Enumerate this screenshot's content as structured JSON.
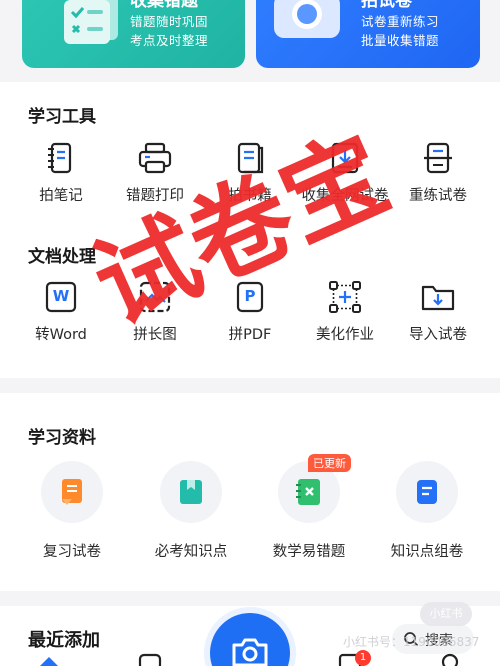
{
  "top_cards": {
    "left": {
      "title": "收集错题",
      "line1": "错题随时巩固",
      "line2": "考点及时整理"
    },
    "right": {
      "title": "拍试卷",
      "line1": "试卷重新练习",
      "line2": "批量收集错题"
    }
  },
  "tools": {
    "title": "学习工具",
    "items": [
      "拍笔记",
      "错题打印",
      "拍书籍",
      "收集全网试卷",
      "重练试卷"
    ]
  },
  "docs": {
    "title": "文档处理",
    "items": [
      "转Word",
      "拼长图",
      "拼PDF",
      "美化作业",
      "导入试卷"
    ],
    "word_letter": "W",
    "pdf_letter": "P"
  },
  "study": {
    "title": "学习资料",
    "items": [
      "复习试卷",
      "必考知识点",
      "数学易错题",
      "知识点组卷"
    ],
    "badge": "已更新"
  },
  "recent": {
    "title": "最近添加"
  },
  "search": {
    "label": "搜索"
  },
  "nav": {
    "notification_count": "1"
  },
  "watermark": {
    "text": "小红书号：1190086837",
    "chip": "小红书"
  },
  "stamp": {
    "text": "试卷宝"
  },
  "colors": {
    "green": "#23bba9",
    "blue": "#2470f6",
    "stamp_red": "#ee2a2a",
    "badge": "#ff5a3c"
  }
}
